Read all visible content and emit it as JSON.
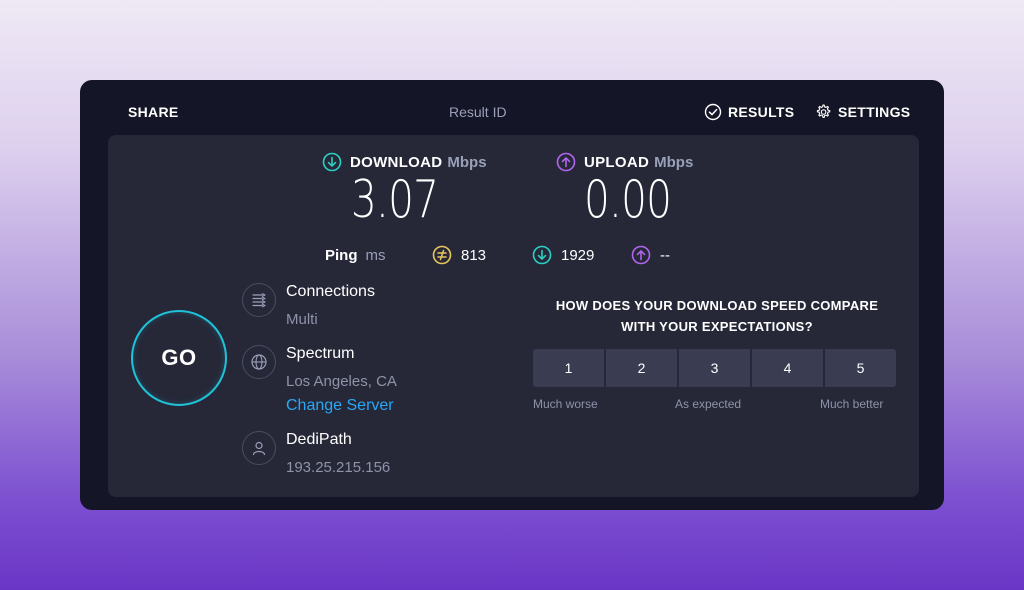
{
  "header": {
    "share": "SHARE",
    "result_id": "Result ID",
    "results": "RESULTS",
    "settings": "SETTINGS"
  },
  "download": {
    "label": "DOWNLOAD",
    "unit": "Mbps",
    "value": "3.07",
    "color": "#2bd0c4"
  },
  "upload": {
    "label": "UPLOAD",
    "unit": "Mbps",
    "value": "0.00",
    "color": "#b264f0"
  },
  "ping": {
    "label": "Ping",
    "unit": "ms",
    "idle": "813",
    "download": "1929",
    "upload": "--",
    "idle_color": "#e8c55a"
  },
  "go": {
    "label": "GO",
    "color": "#1fc3d8"
  },
  "connections": {
    "title": "Connections",
    "value": "Multi"
  },
  "isp": {
    "title": "Spectrum",
    "location": "Los Angeles, CA",
    "change_server": "Change Server"
  },
  "host": {
    "title": "DediPath",
    "ip": "193.25.215.156"
  },
  "survey": {
    "question_line1": "HOW DOES YOUR DOWNLOAD SPEED COMPARE",
    "question_line2": "WITH YOUR EXPECTATIONS?",
    "options": [
      "1",
      "2",
      "3",
      "4",
      "5"
    ],
    "scale_left": "Much worse",
    "scale_mid": "As expected",
    "scale_right": "Much better"
  }
}
